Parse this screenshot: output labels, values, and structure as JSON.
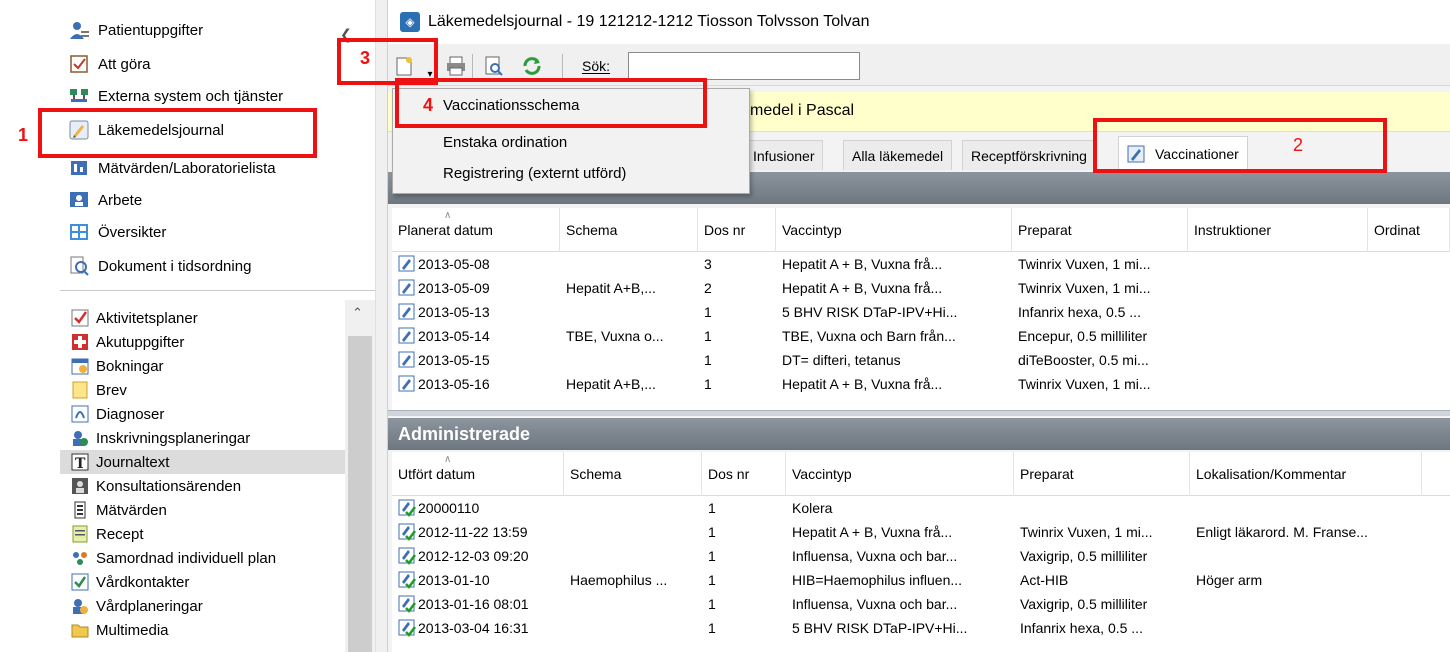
{
  "window_title": "Läkemedelsjournal - 19 121212-1212 Tiosson Tolvsson Tolvan",
  "left_nav": {
    "items": [
      {
        "label": "Patientuppgifter",
        "icon": "person-icon"
      },
      {
        "label": "Att göra",
        "icon": "checklist-icon"
      },
      {
        "label": "Externa system och tjänster",
        "icon": "network-icon"
      },
      {
        "label": "Läkemedelsjournal",
        "icon": "medication-journal-icon"
      },
      {
        "label": "Mätvärden/Laboratorielista",
        "icon": "lab-icon"
      },
      {
        "label": "Arbete",
        "icon": "work-icon"
      },
      {
        "label": "Översikter",
        "icon": "overview-icon"
      },
      {
        "label": "Dokument i tidsordning",
        "icon": "document-search-icon"
      }
    ],
    "list": [
      {
        "label": "Aktivitetsplaner",
        "icon": "activity-plan-icon"
      },
      {
        "label": "Akutuppgifter",
        "icon": "emergency-icon"
      },
      {
        "label": "Bokningar",
        "icon": "booking-icon"
      },
      {
        "label": "Brev",
        "icon": "letter-icon"
      },
      {
        "label": "Diagnoser",
        "icon": "diagnosis-icon"
      },
      {
        "label": "Inskrivningsplaneringar",
        "icon": "admission-icon"
      },
      {
        "label": "Journaltext",
        "icon": "text-icon",
        "selected": true
      },
      {
        "label": "Konsultationsärenden",
        "icon": "consultation-icon"
      },
      {
        "label": "Mätvärden",
        "icon": "measurement-icon"
      },
      {
        "label": "Recept",
        "icon": "prescription-icon"
      },
      {
        "label": "Samordnad individuell plan",
        "icon": "coordination-icon"
      },
      {
        "label": "Vårdkontakter",
        "icon": "care-contact-icon"
      },
      {
        "label": "Vårdplaneringar",
        "icon": "care-plan-icon"
      },
      {
        "label": "Multimedia",
        "icon": "folder-icon"
      }
    ]
  },
  "toolbar": {
    "search_label": "Sök:",
    "search_value": ""
  },
  "yellow_bar_text": "medel i Pascal",
  "tabs": [
    {
      "label": "Infusioner"
    },
    {
      "label": "Alla läkemedel"
    },
    {
      "label": "Receptförskrivning"
    },
    {
      "label": "Vaccinationer",
      "active": true
    }
  ],
  "dropdown": {
    "items": [
      {
        "label": "Vaccinationsschema"
      },
      {
        "label": "Enstaka ordination"
      },
      {
        "label": "Registrering (externt utförd)"
      }
    ]
  },
  "planned": {
    "columns": [
      "Planerat datum",
      "Schema",
      "Dos nr",
      "Vaccintyp",
      "Preparat",
      "Instruktioner",
      "Ordinat"
    ],
    "rows": [
      [
        "2013-05-08",
        "",
        "3",
        "Hepatit A + B, Vuxna frå...",
        "Twinrix Vuxen, 1 mi...",
        "",
        ""
      ],
      [
        "2013-05-09",
        "Hepatit A+B,...",
        "2",
        "Hepatit A + B, Vuxna frå...",
        "Twinrix Vuxen, 1 mi...",
        "",
        ""
      ],
      [
        "2013-05-13",
        "",
        "1",
        "5 BHV RISK DTaP-IPV+Hi...",
        "Infanrix hexa, 0.5 ...",
        "",
        ""
      ],
      [
        "2013-05-14",
        "TBE, Vuxna o...",
        "1",
        "TBE, Vuxna och Barn från...",
        "Encepur, 0.5 milliliter",
        "",
        ""
      ],
      [
        "2013-05-15",
        "",
        "1",
        "DT= difteri, tetanus",
        "diTeBooster, 0.5 mi...",
        "",
        ""
      ],
      [
        "2013-05-16",
        "Hepatit A+B,...",
        "1",
        "Hepatit A + B, Vuxna frå...",
        "Twinrix Vuxen, 1 mi...",
        "",
        ""
      ]
    ]
  },
  "administered": {
    "title": "Administrerade",
    "columns": [
      "Utfört datum",
      "Schema",
      "Dos nr",
      "Vaccintyp",
      "Preparat",
      "Lokalisation/Kommentar"
    ],
    "rows": [
      [
        "20000110",
        "",
        "1",
        "Kolera",
        "",
        ""
      ],
      [
        "2012-11-22 13:59",
        "",
        "1",
        "Hepatit A + B, Vuxna frå...",
        "Twinrix Vuxen, 1 mi...",
        "Enligt läkarord. M. Franse..."
      ],
      [
        "2012-12-03 09:20",
        "",
        "1",
        "Influensa, Vuxna och bar...",
        "Vaxigrip, 0.5 milliliter",
        ""
      ],
      [
        "2013-01-10",
        "Haemophilus ...",
        "1",
        "HIB=Haemophilus influen...",
        "Act-HIB",
        "Höger arm"
      ],
      [
        "2013-01-16 08:01",
        "",
        "1",
        "Influensa, Vuxna och bar...",
        "Vaxigrip, 0.5 milliliter",
        ""
      ],
      [
        "2013-03-04 16:31",
        "",
        "1",
        "5 BHV RISK DTaP-IPV+Hi...",
        "Infanrix hexa, 0.5 ...",
        ""
      ]
    ]
  },
  "annotations": [
    "1",
    "2",
    "3",
    "4"
  ],
  "colors": {
    "annotation_red": "#ee1111",
    "section_header": "#7a838c",
    "yellow_bar": "#ffffcc",
    "selected_item": "#dcdcdc"
  }
}
